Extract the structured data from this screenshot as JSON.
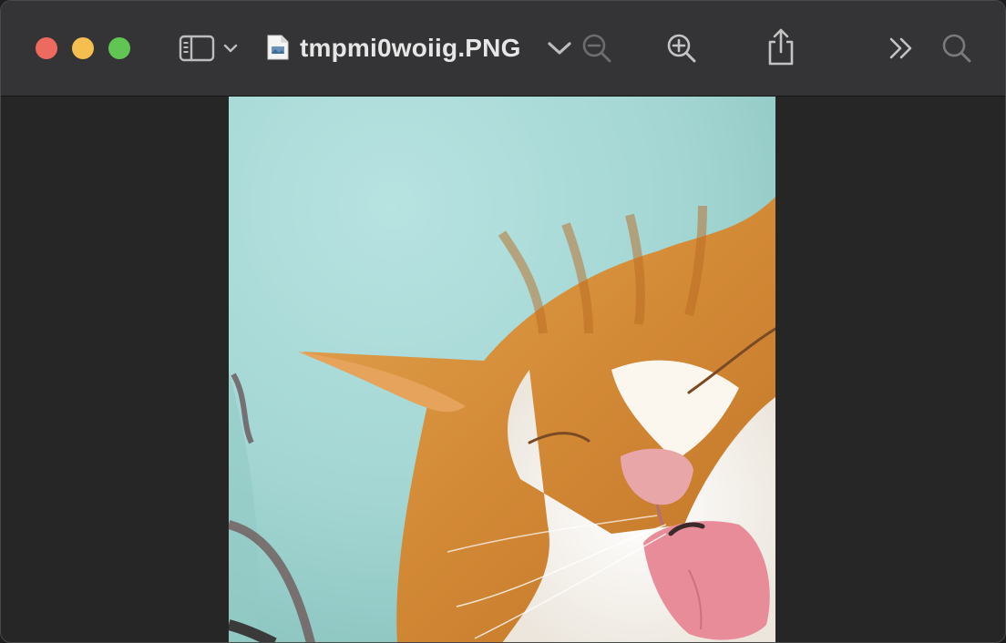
{
  "window": {
    "title": "tmpmi0woiig.PNG",
    "traffic_lights": {
      "close_color": "#ed6a5e",
      "minimize_color": "#f5bf4f",
      "zoom_color": "#61c554"
    }
  },
  "toolbar": {
    "sidebar_toggle_icon": "sidebar-icon",
    "sidebar_menu_icon": "chevron-down-icon",
    "document_icon": "png-document-icon",
    "title_menu_icon": "chevron-down-icon",
    "zoom_out_icon": "zoom-out-icon",
    "zoom_in_icon": "zoom-in-icon",
    "share_icon": "share-icon",
    "overflow_icon": "double-chevron-right-icon",
    "search_icon": "search-icon"
  },
  "image": {
    "subject": "orange-and-white-cat",
    "background_color": "#a9d8d6"
  }
}
